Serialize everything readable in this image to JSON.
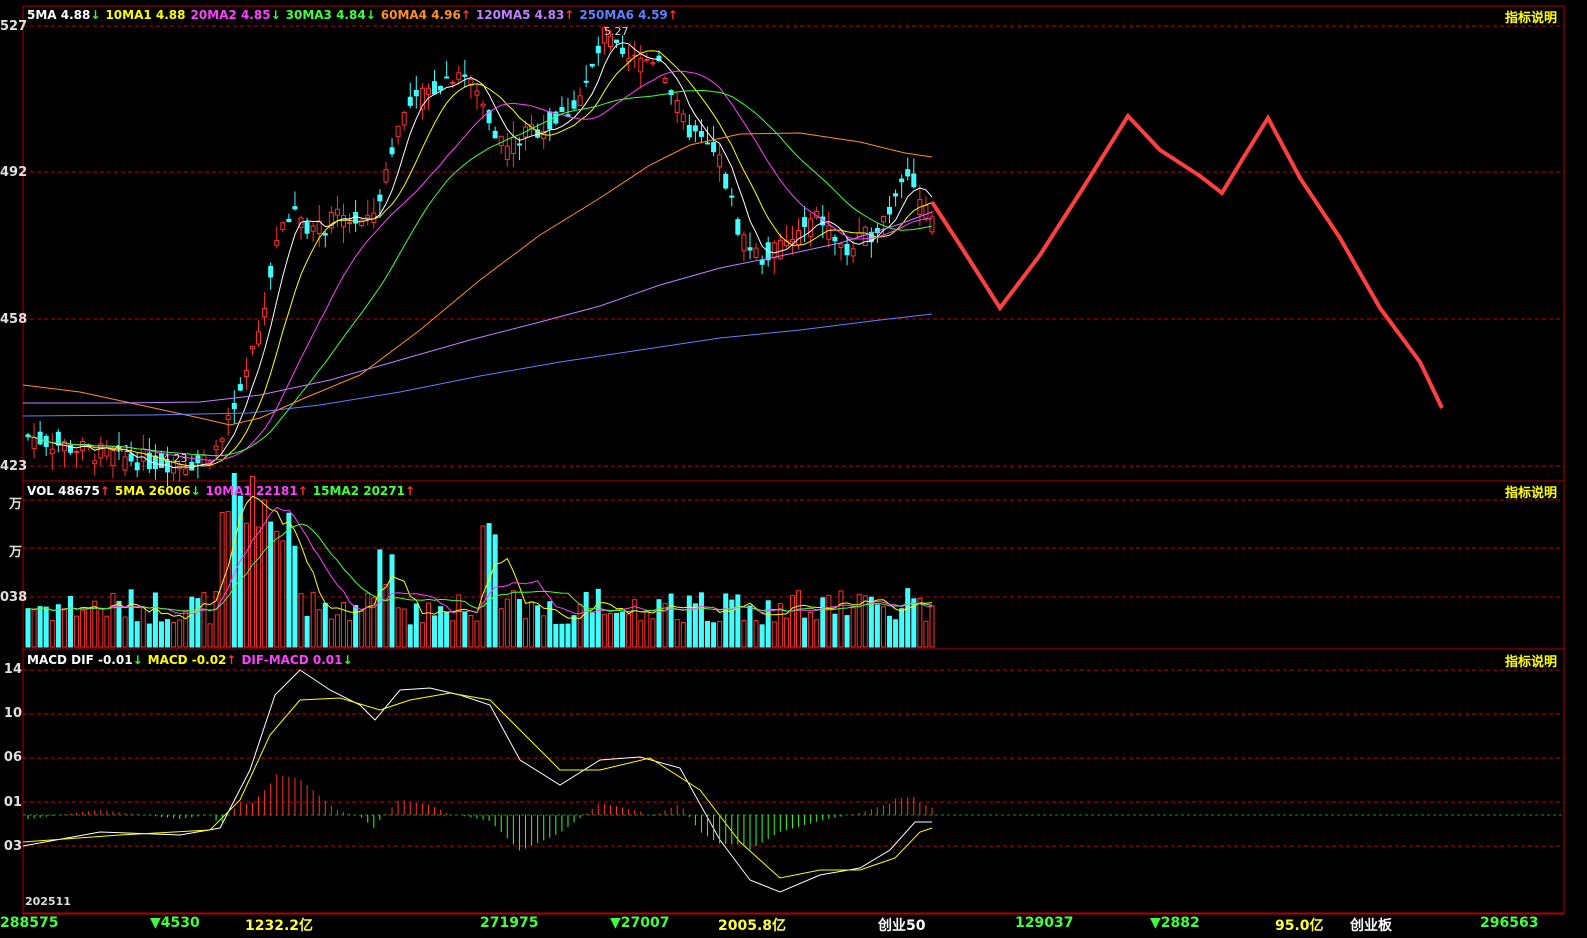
{
  "colors": {
    "up": "#ff3030",
    "down": "#40ffff",
    "frame": "#b00000",
    "grid": "#c00000",
    "ma5": "#ffffff",
    "ma10": "#ffff00",
    "ma20": "#ff40ff",
    "ma30": "#40ff40",
    "ma60": "#ff9020",
    "ma120": "#c080ff",
    "ma250": "#6080ff",
    "prediction": "#ff4040"
  },
  "price_panel": {
    "legend": [
      {
        "label": "5MA",
        "value": "4.88",
        "arrow": "↓",
        "dir": "dn",
        "color": "#ffffff"
      },
      {
        "label": "10MA1",
        "value": "4.88",
        "arrow": "",
        "dir": "",
        "color": "#ffff00"
      },
      {
        "label": "20MA2",
        "value": "4.85",
        "arrow": "↓",
        "dir": "dn",
        "color": "#ff40ff"
      },
      {
        "label": "30MA3",
        "value": "4.84",
        "arrow": "↓",
        "dir": "dn",
        "color": "#40ff40"
      },
      {
        "label": "60MA4",
        "value": "4.96",
        "arrow": "↑",
        "dir": "up",
        "color": "#ff9020"
      },
      {
        "label": "120MA5",
        "value": "4.83",
        "arrow": "↑",
        "dir": "up",
        "color": "#c080ff"
      },
      {
        "label": "250MA6",
        "value": "4.59",
        "arrow": "↑",
        "dir": "up",
        "color": "#6080ff"
      }
    ],
    "help": "指标说明",
    "yticks": [
      "527",
      "492",
      "458",
      "423"
    ],
    "high_label": "5.27",
    "low_label": "4.23",
    "small_label": "4.1"
  },
  "volume_panel": {
    "legend": [
      {
        "label": "VOL",
        "value": "48675",
        "arrow": "↑",
        "dir": "up",
        "color": "#ffffff"
      },
      {
        "label": "5MA",
        "value": "26006",
        "arrow": "↓",
        "dir": "dn",
        "color": "#ffff00"
      },
      {
        "label": "10MA1",
        "value": "22181",
        "arrow": "↑",
        "dir": "up",
        "color": "#ff40ff"
      },
      {
        "label": "15MA2",
        "value": "20271",
        "arrow": "↑",
        "dir": "up",
        "color": "#40ff40"
      }
    ],
    "help": "指标说明",
    "yticks": [
      "万",
      "万",
      "038"
    ]
  },
  "macd_panel": {
    "legend": [
      {
        "label": "MACD DIF",
        "value": "-0.01",
        "arrow": "↓",
        "dir": "dn",
        "color": "#ffffff"
      },
      {
        "label": "MACD",
        "value": "-0.02",
        "arrow": "↑",
        "dir": "up",
        "color": "#ffff00"
      },
      {
        "label": "DIF-MACD",
        "value": "0.01",
        "arrow": "↓",
        "dir": "dn",
        "color": "#ff40ff"
      }
    ],
    "help": "指标说明",
    "yticks": [
      "14",
      "10",
      "06",
      "01",
      "03"
    ]
  },
  "date_label": "202511",
  "status_bar": [
    {
      "text": "288575",
      "color": "#40ff40"
    },
    {
      "text": "▼4530",
      "color": "#40ff40"
    },
    {
      "text": "1232.2亿",
      "color": "#ffff40"
    },
    {
      "text": "271975",
      "color": "#40ff40"
    },
    {
      "text": "▼27007",
      "color": "#40ff40"
    },
    {
      "text": "2005.8亿",
      "color": "#ffff40"
    },
    {
      "text": "创业50",
      "color": "#ffffff"
    },
    {
      "text": "129037",
      "color": "#40ff40"
    },
    {
      "text": "▼2882",
      "color": "#40ff40"
    },
    {
      "text": "95.0亿",
      "color": "#ffff40"
    },
    {
      "text": "创业板",
      "color": "#ffffff"
    },
    {
      "text": "296563",
      "color": "#40ff40"
    }
  ],
  "chart_data": {
    "type": "line",
    "series": [
      {
        "name": "",
        "values": [
          4.3,
          4.31,
          4.3,
          4.29,
          4.28,
          4.27,
          4.26,
          4.25,
          4.24,
          4.24,
          4.23,
          4.24,
          4.25,
          4.28,
          4.32,
          4.38,
          4.45,
          4.52,
          4.6,
          4.68,
          4.78,
          4.85,
          4.86,
          4.84,
          4.82,
          4.8,
          4.82,
          4.84,
          4.88,
          4.98,
          5.06,
          5.1,
          5.14,
          5.12,
          5.08,
          5.05,
          5.04,
          5.0,
          5.02,
          5.03,
          5.06,
          5.1,
          5.16,
          5.22,
          5.24,
          5.22,
          5.2,
          5.18,
          5.1,
          5.04,
          4.98,
          4.94,
          4.88,
          4.86,
          4.85,
          4.84,
          4.85,
          4.86,
          4.84,
          4.82,
          4.86,
          4.88,
          4.9,
          4.94,
          4.91,
          4.88,
          4.84
        ]
      }
    ],
    "ylim": [
      4.23,
      5.27
    ],
    "grid": true
  }
}
